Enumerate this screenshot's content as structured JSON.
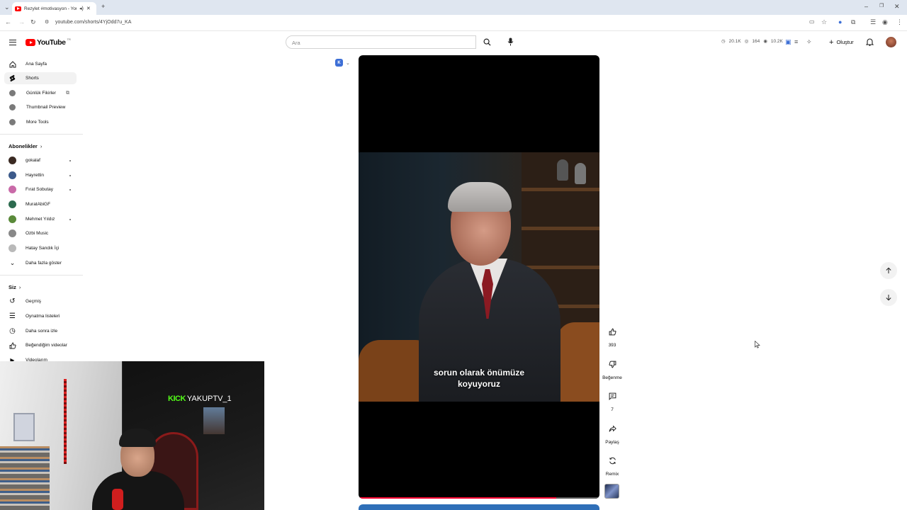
{
  "browser": {
    "tab_title": "Rezylet #motivasyon - YouT",
    "url": "youtube.com/shorts/4YjOdd7u_KA"
  },
  "masthead": {
    "logo_text": "YouTube",
    "logo_sup": "TR",
    "search_placeholder": "Ara",
    "stats": [
      "20.1K",
      "164",
      "10.2K"
    ],
    "create_label": "Oluştur"
  },
  "sidebar": {
    "main": [
      {
        "label": "Ana Sayfa",
        "icon": "home-icon"
      },
      {
        "label": "Shorts",
        "icon": "shorts-icon",
        "active": true
      }
    ],
    "tools": [
      {
        "label": "Günlük Fikirler",
        "external": true
      },
      {
        "label": "Thumbnail Preview"
      },
      {
        "label": "More Tools"
      }
    ],
    "subscriptions_title": "Abonelikler",
    "subscriptions": [
      {
        "label": "gokalaf",
        "color": "#3a2a22",
        "dot": true
      },
      {
        "label": "Hayrettin",
        "color": "#3c5a8a",
        "dot": true
      },
      {
        "label": "Fırat Sobutay",
        "color": "#c96aa8",
        "dot": true
      },
      {
        "label": "MuratAbiGF",
        "color": "#2d6b4f",
        "dot": false
      },
      {
        "label": "Mehmet Yıldız",
        "color": "#5a8a3a",
        "dot": true
      },
      {
        "label": "Ozbi Music",
        "color": "#888888",
        "dot": false
      },
      {
        "label": "Hatay Sandık İçi",
        "color": "#b9b9b9",
        "dot": false
      }
    ],
    "show_more": "Daha fazla göster",
    "you_title": "Siz",
    "you": [
      {
        "label": "Geçmiş",
        "icon": "history-icon"
      },
      {
        "label": "Oynatma listeleri",
        "icon": "playlist-icon"
      },
      {
        "label": "Daha sonra izle",
        "icon": "watch-later-icon"
      },
      {
        "label": "Beğendiğim videolar",
        "icon": "like-icon"
      },
      {
        "label": "Videolarım",
        "icon": "video-icon"
      }
    ]
  },
  "webcam": {
    "kick_logo": "KICK",
    "kick_user": "YAKUPTV_1"
  },
  "short": {
    "caption_line1": "sorun olarak önümüze",
    "caption_line2": "koyuyoruz",
    "progress": 0.82
  },
  "actions": {
    "like_count": "393",
    "dislike_label": "Beğenme",
    "comment_count": "7",
    "share_label": "Paylaş",
    "remix_label": "Remix"
  },
  "colors": {
    "youtube_red": "#ff0000",
    "kick_green": "#53fc18",
    "progress_red": "#ff0033"
  }
}
